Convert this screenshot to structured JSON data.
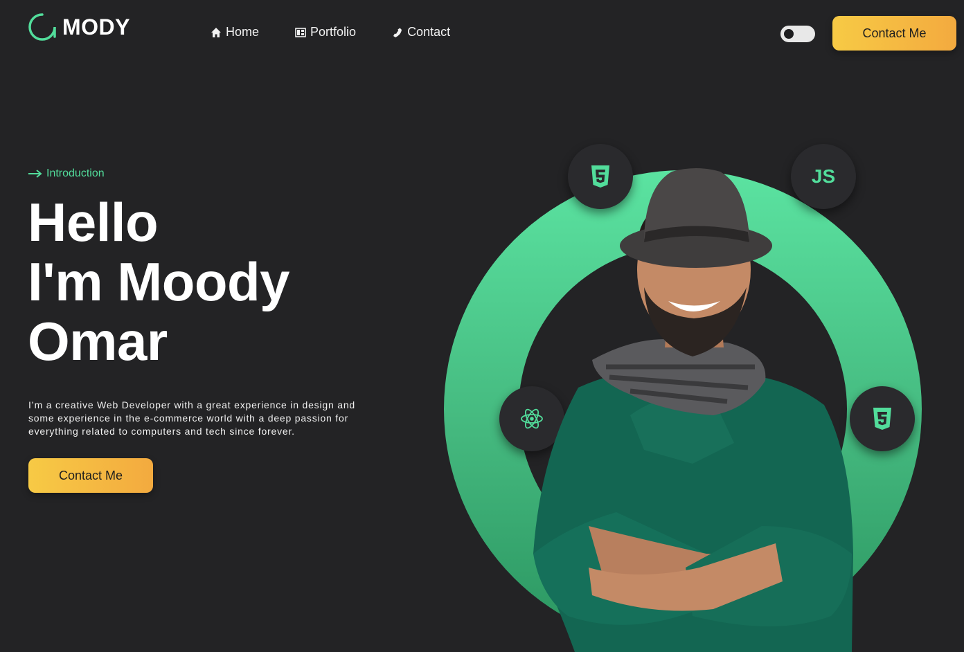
{
  "header": {
    "logo_text": "MODY",
    "nav": [
      {
        "label": "Home",
        "icon": "home-icon"
      },
      {
        "label": "Portfolio",
        "icon": "portfolio-icon"
      },
      {
        "label": "Contact",
        "icon": "phone-icon"
      }
    ],
    "theme_toggle": {
      "state": "off"
    },
    "cta_label": "Contact Me"
  },
  "hero": {
    "intro_label": "Introduction",
    "headline_lines": [
      "Hello",
      "I'm Moody",
      "Omar"
    ],
    "description": "I’m a creative Web Developer with a great experience in design and some experience in the e-commerce world with a deep passion for everything related to computers and tech since forever.",
    "cta_label": "Contact Me"
  },
  "tech_badges": {
    "js_label": "JS",
    "icons": [
      "html5-icon",
      "js-icon",
      "react-icon",
      "css3-icon"
    ]
  },
  "colors": {
    "accent": "#52dd9b",
    "background": "#232325",
    "button_gradient_start": "#f7ca45",
    "button_gradient_end": "#f3aa3f"
  }
}
